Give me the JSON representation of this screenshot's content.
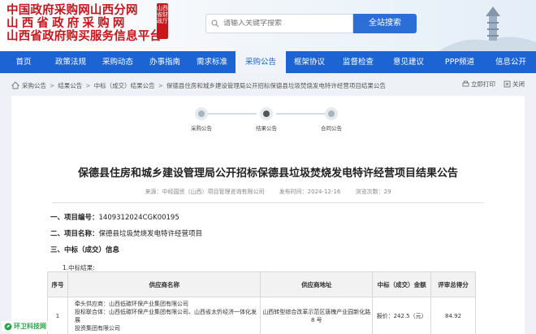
{
  "header": {
    "title_line1": "中国政府采购网山西分网",
    "title_line2": "山西省政府采购网",
    "title_line3": "山西省政府购买服务信息平台",
    "seal_text": "山西省财政厅",
    "search_placeholder": "请输入关键字搜索",
    "search_button": "全站搜索"
  },
  "nav": {
    "items": [
      {
        "label": "首页"
      },
      {
        "label": "政策法规"
      },
      {
        "label": "采购动态"
      },
      {
        "label": "办事指南"
      },
      {
        "label": "需求标准"
      },
      {
        "label": "采购公告",
        "active": true
      },
      {
        "label": "框架协议"
      },
      {
        "label": "监督检查"
      },
      {
        "label": "意见建议"
      },
      {
        "label": "PPP频道"
      },
      {
        "label": "信息公开"
      }
    ]
  },
  "breadcrumb": {
    "items": [
      "采购公告",
      "结果公告",
      "中标（成交）结果公告",
      "保德县住房和城乡建设管理局公开招标保德县垃圾焚烧发电特许经营项目结果公告"
    ],
    "print_label": "立即打印",
    "close_label": "关闭"
  },
  "steps": [
    "采购公告",
    "结果公告",
    "合同公告"
  ],
  "article": {
    "title": "保德县住房和城乡建设管理局公开招标保德县垃圾焚烧发电特许经营项目结果公告",
    "source": "来源：中经国贸（山西）项目管理咨询有限公司",
    "publish_time": "发布时间：2024-12-16",
    "views": "浏览次数：29",
    "sec1_label": "一、项目编号：",
    "sec1_value": "1409312024CGK00195",
    "sec2_label": "二、项目名称：",
    "sec2_value": "保德县垃圾焚烧发电特许经营项目",
    "sec3_label": "三、中标（成交）信息",
    "sub_label": "1.中标结果:"
  },
  "table": {
    "headers": [
      "序号",
      "供应商名称",
      "供应商地址",
      "中标（成交）金额",
      "评审总得分"
    ],
    "rows": [
      {
        "no": "1",
        "name_line1": "牵头供应商：山西低碳环保产业集团有限公司",
        "name_line2": "投标联合体：山西低碳环保产业集团有限公司、山西省太忻经济一体化发展",
        "name_line3": "投资集团有限公司",
        "address": "山西转型综合改革示范区唐槐产业园新化路 8 号",
        "amount": "报价：242.5（元）",
        "score": "84.92"
      }
    ]
  },
  "watermark": "环卫科技网"
}
